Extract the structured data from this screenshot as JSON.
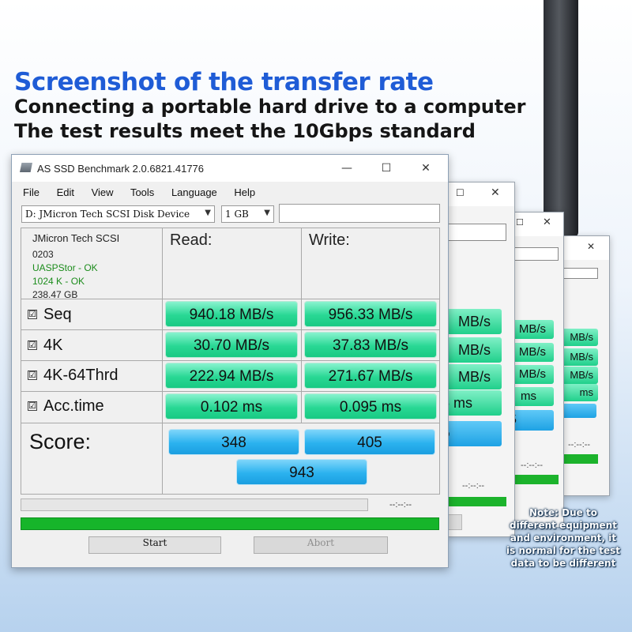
{
  "headline": {
    "title": "Screenshot of the transfer rate",
    "subtitle": "Connecting a portable hard drive to a computer The test results meet the 10Gbps standard"
  },
  "window": {
    "title": "AS SSD Benchmark 2.0.6821.41776",
    "controls": {
      "minimize": "—",
      "maximize": "☐",
      "close": "✕"
    },
    "menu": [
      "File",
      "Edit",
      "View",
      "Tools",
      "Language",
      "Help"
    ],
    "drive_select": "D: JMicron Tech SCSI Disk Device",
    "size_select": "1 GB",
    "device": {
      "name": "JMicron Tech SCSI",
      "firmware": "0203",
      "driver_status": "UASPStor - OK",
      "alignment_status": "1024 K - OK",
      "capacity": "238.47 GB"
    },
    "columns": {
      "read": "Read:",
      "write": "Write:"
    },
    "rows": [
      {
        "label": "Seq",
        "checked": "☑",
        "read": "940.18 MB/s",
        "write": "956.33 MB/s"
      },
      {
        "label": "4K",
        "checked": "☑",
        "read": "30.70 MB/s",
        "write": "37.83 MB/s"
      },
      {
        "label": "4K-64Thrd",
        "checked": "☑",
        "read": "222.94 MB/s",
        "write": "271.67 MB/s"
      },
      {
        "label": "Acc.time",
        "checked": "☑",
        "read": "0.102 ms",
        "write": "0.095 ms"
      }
    ],
    "score": {
      "label": "Score:",
      "read": "348",
      "write": "405",
      "total": "943"
    },
    "elapsed_time": "--:--:--",
    "buttons": {
      "start": "Start",
      "abort": "Abort"
    }
  },
  "ghost_windows": [
    {
      "cells": [
        "MB/s",
        "MB/s",
        "MB/s",
        "5 ms"
      ],
      "score": "5",
      "time": "--:--:--"
    },
    {
      "cells": [
        "MB/s",
        "MB/s",
        "MB/s",
        "ms"
      ],
      "score": "5",
      "time": "--:--:--"
    },
    {
      "cells": [
        "MB/s",
        "MB/s",
        "MB/s",
        "ms"
      ],
      "score": "",
      "time": "--:--:--"
    }
  ],
  "note": "Note: Due to different equipment and environment, it is normal for the test data to be different"
}
